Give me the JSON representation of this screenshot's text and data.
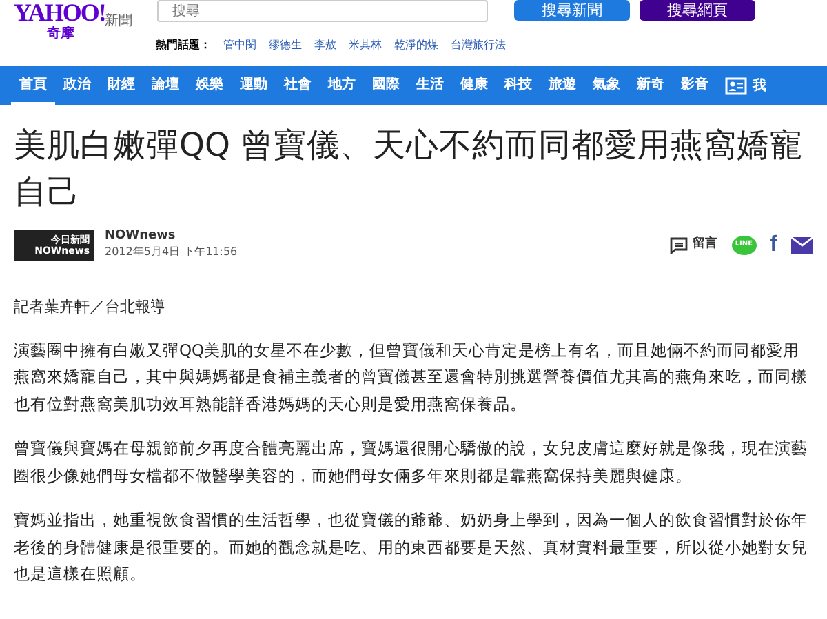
{
  "header": {
    "logo": "YAHOO!",
    "logo_sub": "奇摩",
    "section": "新聞",
    "search": {
      "placeholder": "搜尋"
    },
    "buttons": [
      {
        "label": "搜尋新聞",
        "kind": "news"
      },
      {
        "label": "搜尋網頁",
        "kind": "web"
      }
    ],
    "hot_topics": {
      "label": "熱門話題：",
      "items": [
        "管中閔",
        "繆德生",
        "李敖",
        "米其林",
        "乾淨的煤",
        "台灣旅行法"
      ]
    }
  },
  "nav": {
    "items": [
      {
        "label": "首頁",
        "selected": true
      },
      {
        "label": "政治",
        "selected": false
      },
      {
        "label": "財經",
        "selected": false
      },
      {
        "label": "論壇",
        "selected": false
      },
      {
        "label": "娛樂",
        "selected": false
      },
      {
        "label": "運動",
        "selected": false
      },
      {
        "label": "社會",
        "selected": false
      },
      {
        "label": "地方",
        "selected": false
      },
      {
        "label": "國際",
        "selected": false
      },
      {
        "label": "生活",
        "selected": false
      },
      {
        "label": "健康",
        "selected": false
      },
      {
        "label": "科技",
        "selected": false
      },
      {
        "label": "旅遊",
        "selected": false
      },
      {
        "label": "氣象",
        "selected": false
      },
      {
        "label": "新奇",
        "selected": false
      },
      {
        "label": "影音",
        "selected": false
      }
    ],
    "account": "我"
  },
  "article": {
    "title": "美肌白嫩彈QQ 曾寶儀、天心不約而同都愛用燕窩嬌寵自己",
    "source": {
      "logo_top": "今日新聞",
      "logo_bottom": "NOWnews",
      "name": "NOWnews",
      "date": "2012年5月4日 下午11:56"
    },
    "share": {
      "comment": "留言",
      "line": "LINE",
      "facebook": "f"
    },
    "byline": "記者葉卉軒／台北報導",
    "paragraphs": [
      "演藝圈中擁有白嫩又彈QQ美肌的女星不在少數，但曾寶儀和天心肯定是榜上有名，而且她倆不約而同都愛用燕窩來嬌寵自己，其中與媽媽都是食補主義者的曾寶儀甚至還會特別挑選營養價值尤其高的燕角來吃，而同樣也有位對燕窩美肌功效耳熟能詳香港媽媽的天心則是愛用燕窩保養品。",
      "曾寶儀與寶媽在母親節前夕再度合體亮麗出席，寶媽還很開心驕傲的說，女兒皮膚這麼好就是像我，現在演藝圈很少像她們母女檔都不做醫學美容的，而她們母女倆多年來則都是靠燕窩保持美麗與健康。",
      "寶媽並指出，她重視飲食習慣的生活哲學，也從寶儀的爺爺、奶奶身上學到，因為一個人的飲食習慣對於你年老後的身體健康是很重要的。而她的觀念就是吃、用的東西都要是天然、真材實料最重要，所以從小她對女兒也是這樣在照顧。"
    ]
  }
}
